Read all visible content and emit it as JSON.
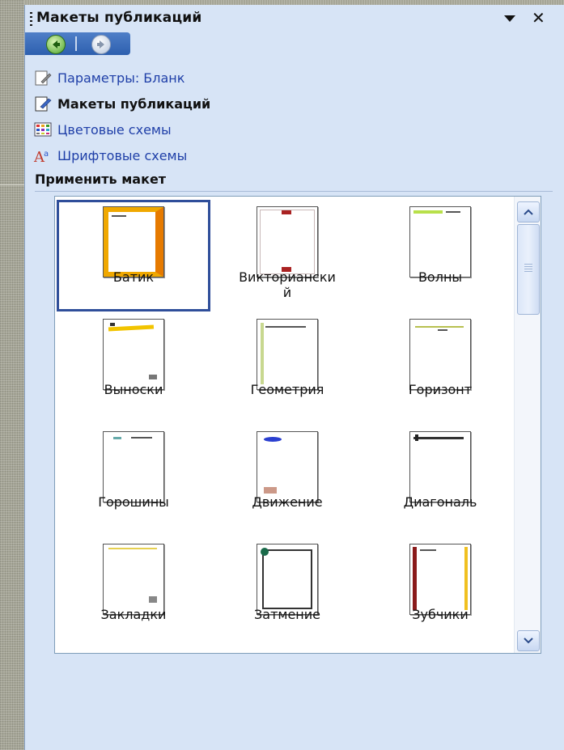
{
  "pane": {
    "title": "Макеты публикаций"
  },
  "links": [
    {
      "label": "Параметры: Бланк",
      "icon": "page-settings-icon",
      "bold": false
    },
    {
      "label": "Макеты публикаций",
      "icon": "page-design-icon",
      "bold": true
    },
    {
      "label": "Цветовые схемы",
      "icon": "color-scheme-icon",
      "bold": false
    },
    {
      "label": "Шрифтовые схемы",
      "icon": "font-scheme-icon",
      "bold": false
    }
  ],
  "section": {
    "title": "Применить макет"
  },
  "designs": [
    {
      "label": "Батик",
      "selected": true,
      "style": "batik"
    },
    {
      "label": "Викториански\nй",
      "selected": false,
      "style": "victorian"
    },
    {
      "label": "Волны",
      "selected": false,
      "style": "waves"
    },
    {
      "label": "Выноски",
      "selected": false,
      "style": "callouts"
    },
    {
      "label": "Геометрия",
      "selected": false,
      "style": "geometry"
    },
    {
      "label": "Горизонт",
      "selected": false,
      "style": "horizon"
    },
    {
      "label": "Горошины",
      "selected": false,
      "style": "peas"
    },
    {
      "label": "Движение",
      "selected": false,
      "style": "motion"
    },
    {
      "label": "Диагональ",
      "selected": false,
      "style": "diagonal"
    },
    {
      "label": "Закладки",
      "selected": false,
      "style": "bookmarks"
    },
    {
      "label": "Затмение",
      "selected": false,
      "style": "eclipse"
    },
    {
      "label": "Зубчики",
      "selected": false,
      "style": "teeth"
    }
  ],
  "colors": {
    "panel_bg": "#d7e4f6",
    "link": "#1f3fa8",
    "selection": "#2f4e9a"
  }
}
